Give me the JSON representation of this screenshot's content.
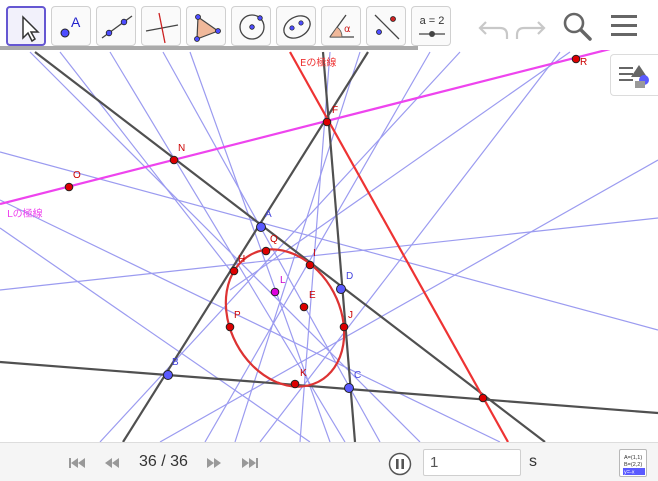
{
  "toolbar": {
    "tools": [
      {
        "name": "move-tool",
        "icon": "cursor-arrow-icon",
        "active": true
      },
      {
        "name": "point-tool",
        "icon": "point-icon",
        "label": "A"
      },
      {
        "name": "line-tool",
        "icon": "line-through-points-icon"
      },
      {
        "name": "perpendicular-line-tool",
        "icon": "perpendicular-line-icon"
      },
      {
        "name": "polygon-tool",
        "icon": "polygon-icon"
      },
      {
        "name": "circle-tool",
        "icon": "circle-center-point-icon"
      },
      {
        "name": "conic-tool",
        "icon": "conic-five-points-icon"
      },
      {
        "name": "angle-tool",
        "icon": "angle-icon",
        "label": "α"
      },
      {
        "name": "reflect-tool",
        "icon": "reflect-about-line-icon"
      },
      {
        "name": "slider-tool",
        "icon": "slider-icon",
        "label": "a = 2"
      }
    ],
    "undo_icon": "undo-icon",
    "redo_icon": "redo-icon",
    "search_icon": "search-icon",
    "menu_icon": "hamburger-menu-icon"
  },
  "graphics": {
    "points": [
      {
        "name": "A",
        "label": "A",
        "kind": "blue"
      },
      {
        "name": "B",
        "label": "B",
        "kind": "blue"
      },
      {
        "name": "C",
        "label": "C",
        "kind": "blue"
      },
      {
        "name": "D",
        "label": "D",
        "kind": "blue"
      },
      {
        "name": "E",
        "label": "E",
        "kind": "red"
      },
      {
        "name": "F",
        "label": "F",
        "kind": "red"
      },
      {
        "name": "H",
        "label": "H",
        "kind": "red"
      },
      {
        "name": "I",
        "label": "I",
        "kind": "red"
      },
      {
        "name": "J",
        "label": "J",
        "kind": "red"
      },
      {
        "name": "K",
        "label": "K",
        "kind": "red"
      },
      {
        "name": "N",
        "label": "N",
        "kind": "red"
      },
      {
        "name": "O",
        "label": "O",
        "kind": "red"
      },
      {
        "name": "P",
        "label": "P",
        "kind": "red"
      },
      {
        "name": "Q",
        "label": "Q",
        "kind": "red"
      },
      {
        "name": "R",
        "label": "R",
        "kind": "red"
      },
      {
        "name": "L",
        "label": "L",
        "kind": "magenta"
      },
      {
        "name": "X",
        "label": "",
        "kind": "red"
      }
    ],
    "polar_E_label": "Eの極線",
    "polar_L_label": "Lの極線",
    "colors": {
      "quad_lines": "#505050",
      "pencil_lines": "#9b9bf0",
      "polar_E": "#ee3333",
      "polar_L": "#ee44ee",
      "conic": "#dd3333",
      "blue_point": "#4d4dff",
      "red_point": "#dd0000",
      "magenta_point": "#dd00dd"
    }
  },
  "style_bar": {
    "icon": "style-bar-toggle-icon"
  },
  "playbar": {
    "first_icon": "skip-to-start-icon",
    "prev_icon": "step-back-icon",
    "step_readout": "36 / 36",
    "next_icon": "step-forward-icon",
    "last_icon": "skip-to-end-icon",
    "pause_icon": "pause-icon",
    "speed_value": "1",
    "speed_unit": "s",
    "algebra_icon": "algebra-view-icon",
    "algebra_lines": [
      "A=(1,1)",
      "B=(2,2)",
      "y=-x"
    ]
  }
}
